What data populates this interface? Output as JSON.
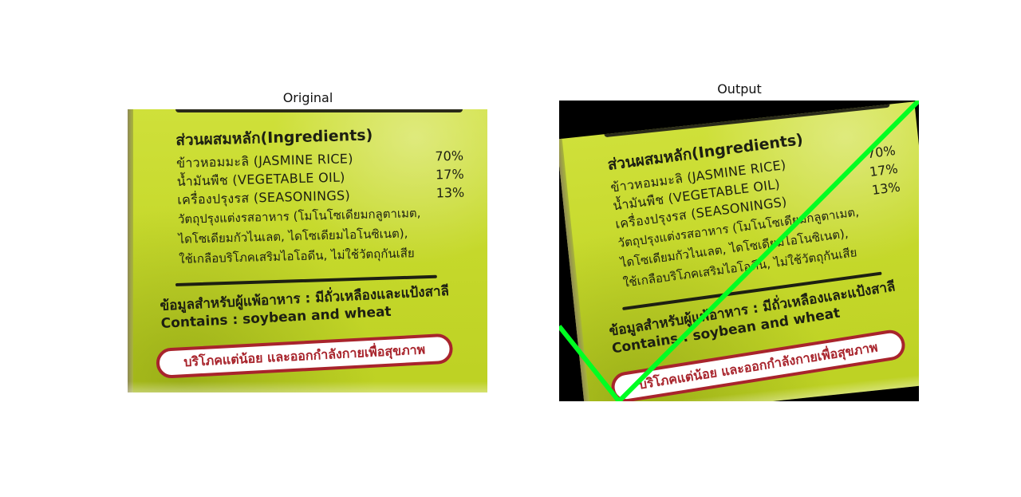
{
  "panels": {
    "left_title": "Original",
    "right_title": "Output"
  },
  "label": {
    "heading": "ส่วนผสมหลัก(Ingredients)",
    "items": [
      {
        "name": "ข้าวหอมมะลิ (JASMINE RICE)",
        "pct": "70%"
      },
      {
        "name": "น้ำมันพืช (VEGETABLE OIL)",
        "pct": "17%"
      },
      {
        "name": "เครื่องปรุงรส (SEASONINGS)",
        "pct": "13%"
      }
    ],
    "note_lines": [
      "วัตถุปรุงแต่งรสอาหาร (โมโนโซเดียมกลูตาเมต,",
      "ไดโซเดียมกัวไนเลต, ไดโซเดียมไอโนซิเนต),",
      "ใช้เกลือบริโภคเสริมไอโอดีน, ไม่ใช้วัตถุกันเสีย"
    ],
    "allergy_thai": "ข้อมูลสำหรับผู้แพ้อาหาร : มีถั่วเหลืองและแป้งสาลี",
    "allergy_en": "Contains : soybean and wheat",
    "slogan": "บริโภคแต่น้อย และออกกำลังกายเพื่อสุขภาพ"
  },
  "colors": {
    "label_green": "#c6d92c",
    "slogan_red": "#a8242c",
    "overlay_line": "#00ff22",
    "output_background": "#000000"
  }
}
